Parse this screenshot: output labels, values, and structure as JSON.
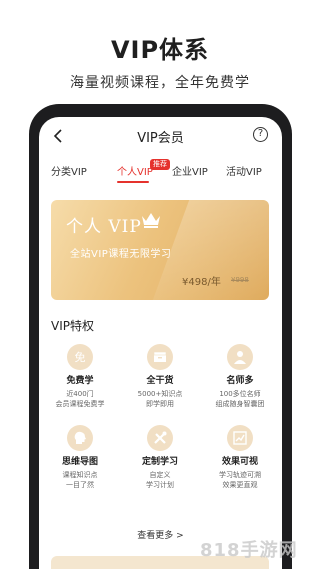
{
  "promo": {
    "title": "VIP体系",
    "subtitle": "海量视频课程，全年免费学"
  },
  "nav": {
    "title": "VIP会员",
    "help_symbol": "?"
  },
  "tabs": [
    {
      "label": "分类VIP"
    },
    {
      "label": "个人VIP",
      "active": true,
      "badge": "推荐"
    },
    {
      "label": "企业VIP"
    },
    {
      "label": "活动VIP"
    }
  ],
  "vip_card": {
    "title": "个人 VIP",
    "subtitle": "全站VIP课程无限学习",
    "price": "¥498/年",
    "original_price": "¥998"
  },
  "perks_section": {
    "title": "VIP特权"
  },
  "perks": [
    {
      "name": "免费学",
      "desc1": "近400门",
      "desc2": "会员课程免费学",
      "icon": "free-icon"
    },
    {
      "name": "全干货",
      "desc1": "5000+知识点",
      "desc2": "即学即用",
      "icon": "box-icon"
    },
    {
      "name": "名师多",
      "desc1": "100多位名师",
      "desc2": "组成随身智囊团",
      "icon": "teacher-icon"
    },
    {
      "name": "思维导图",
      "desc1": "课程知识点",
      "desc2": "一目了然",
      "icon": "brain-icon"
    },
    {
      "name": "定制学习",
      "desc1": "自定义",
      "desc2": "学习计划",
      "icon": "tools-icon"
    },
    {
      "name": "效果可视",
      "desc1": "学习轨迹可溯",
      "desc2": "效果更直观",
      "icon": "chart-icon"
    }
  ],
  "more": {
    "label": "查看更多 >"
  },
  "watermark": "818手游网",
  "colors": {
    "accent": "#e5322d",
    "gold": "#ecc27d",
    "perk_bg": "#f1dfc4",
    "phone_frame": "#1d1d1f"
  }
}
